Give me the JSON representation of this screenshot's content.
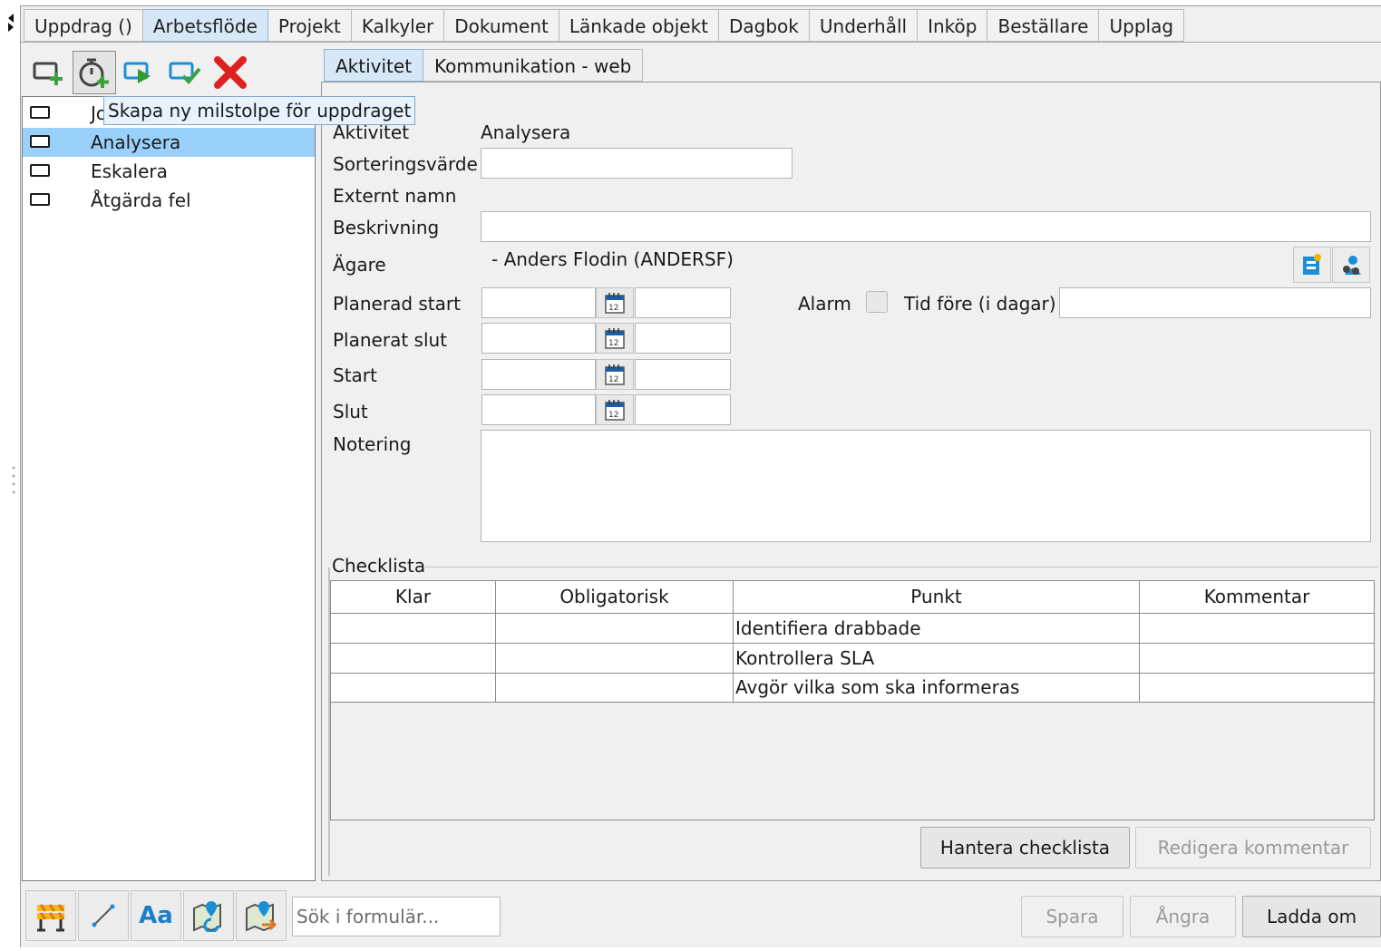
{
  "top_tabs": [
    "Uppdrag ()",
    "Arbetsflöde",
    "Projekt",
    "Kalkyler",
    "Dokument",
    "Länkade objekt",
    "Dagbok",
    "Underhåll",
    "Inköp",
    "Beställare",
    "Upplag"
  ],
  "activities": {
    "items": [
      "Jo",
      "Analysera",
      "Eskalera",
      "Åtgärda fel"
    ],
    "selected": "Analysera"
  },
  "tooltip": "Skapa ny milstolpe för uppdraget",
  "detail_tabs": [
    "Aktivitet",
    "Kommunikation - web"
  ],
  "detail": {
    "aktivitet_label": "Aktivitet",
    "aktivitet_value": "Analysera",
    "sorteringsvarde_label": "Sorteringsvärde",
    "externt_namn_label": "Externt namn",
    "beskrivning_label": "Beskrivning",
    "agare_label": "Ägare",
    "agare_value": "- Anders Flodin (ANDERSF)",
    "planerad_start_label": "Planerad start",
    "planerat_slut_label": "Planerat slut",
    "start_label": "Start",
    "slut_label": "Slut",
    "alarm_label": "Alarm",
    "tid_fore_label": "Tid före (i dagar)",
    "notering_label": "Notering"
  },
  "checklist": {
    "title": "Checklista",
    "columns": [
      "Klar",
      "Obligatorisk",
      "Punkt",
      "Kommentar"
    ],
    "rows": [
      [
        "",
        "",
        "Identifiera drabbade",
        ""
      ],
      [
        "",
        "",
        "Kontrollera SLA",
        ""
      ],
      [
        "",
        "",
        "Avgör vilka som ska informeras",
        ""
      ]
    ],
    "manage_button": "Hantera checklista",
    "edit_comment_button": "Redigera kommentar"
  },
  "bottom": {
    "search_placeholder": "Sök i formulär...",
    "save": "Spara",
    "undo": "Ångra",
    "reload": "Ladda om",
    "font_button": "Aa"
  },
  "colors": {
    "selection": "#99d1fa",
    "active_tab": "#d6e8f7",
    "add_green": "#3aa33a",
    "delete_red": "#e02020",
    "icon_blue": "#1a8fd6"
  }
}
